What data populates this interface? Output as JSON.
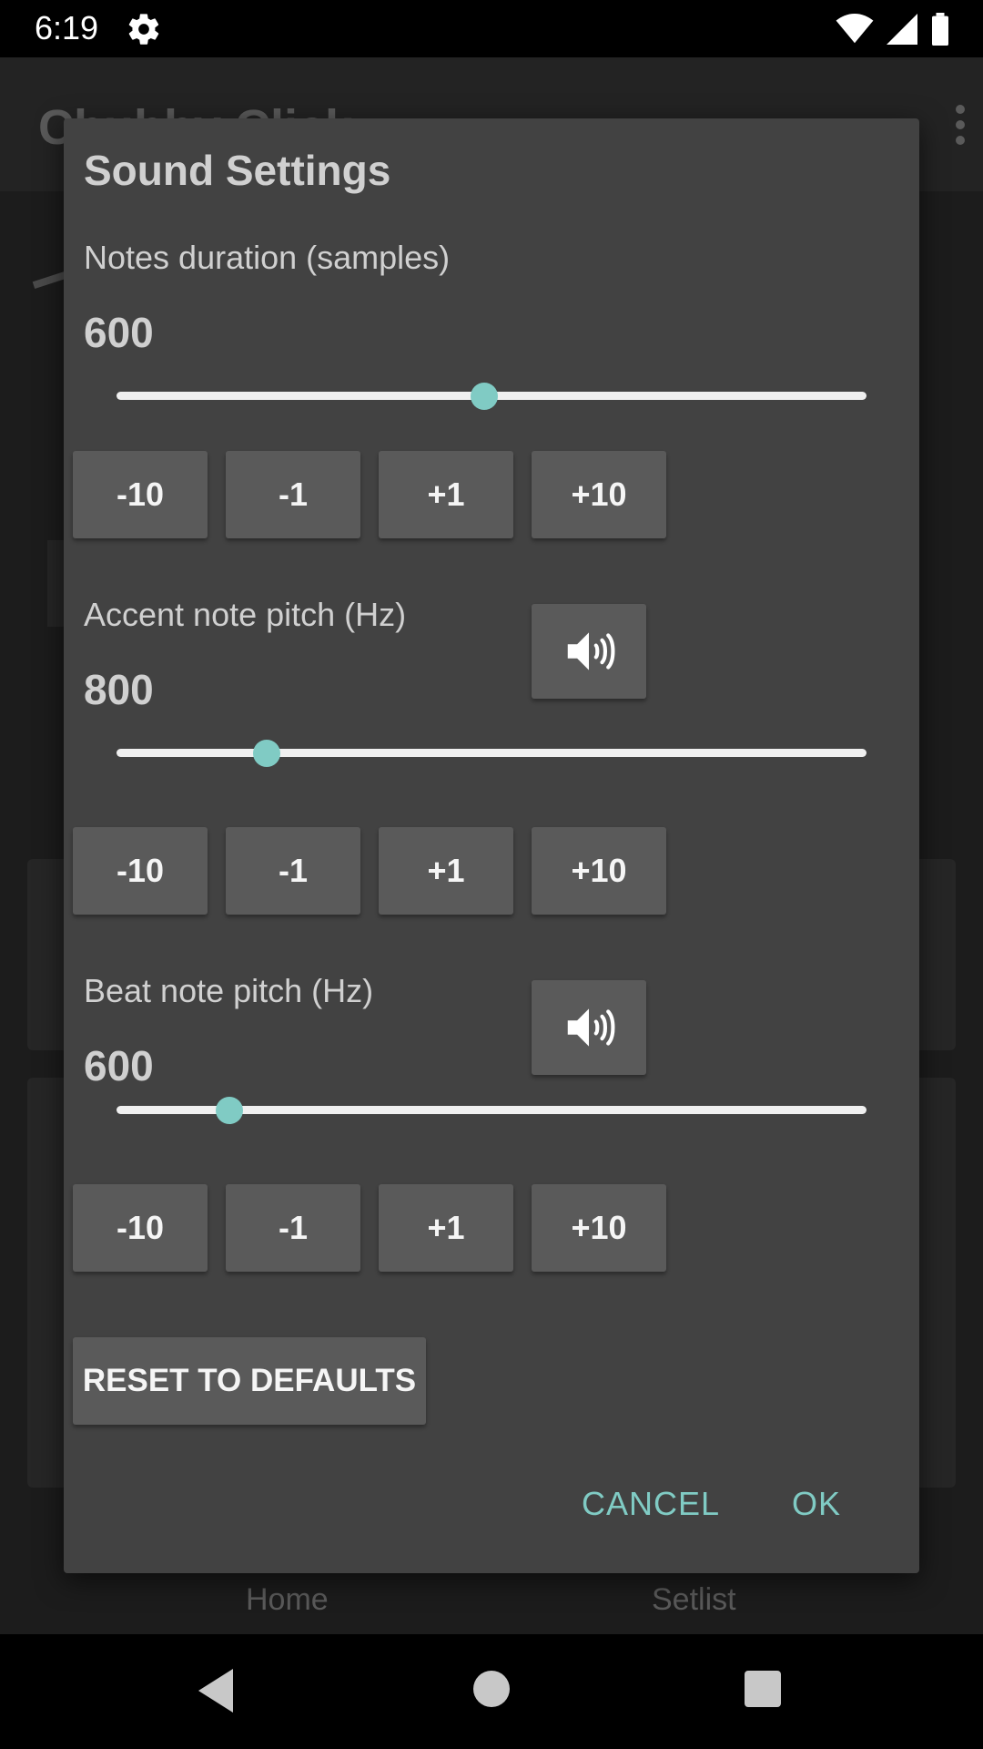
{
  "status_bar": {
    "time": "6:19"
  },
  "background_app": {
    "title": "Chubby Click",
    "tabs": [
      "Home",
      "Setlist"
    ]
  },
  "dialog": {
    "title": "Sound Settings",
    "sections": [
      {
        "label": "Notes duration (samples)",
        "value": "600",
        "slider_fraction": 0.49,
        "has_sound_button": false
      },
      {
        "label": "Accent note pitch (Hz)",
        "value": "800",
        "slider_fraction": 0.2,
        "has_sound_button": true
      },
      {
        "label": "Beat note pitch (Hz)",
        "value": "600",
        "slider_fraction": 0.15,
        "has_sound_button": true
      }
    ],
    "step_buttons": [
      "-10",
      "-1",
      "+1",
      "+10"
    ],
    "sound_icon": "speaker-icon",
    "reset_label": "RESET TO DEFAULTS",
    "cancel_label": "CANCEL",
    "ok_label": "OK"
  },
  "colors": {
    "accent": "#80cbc4",
    "dialog_bg": "#424242",
    "button_bg": "#5a5a5a"
  }
}
